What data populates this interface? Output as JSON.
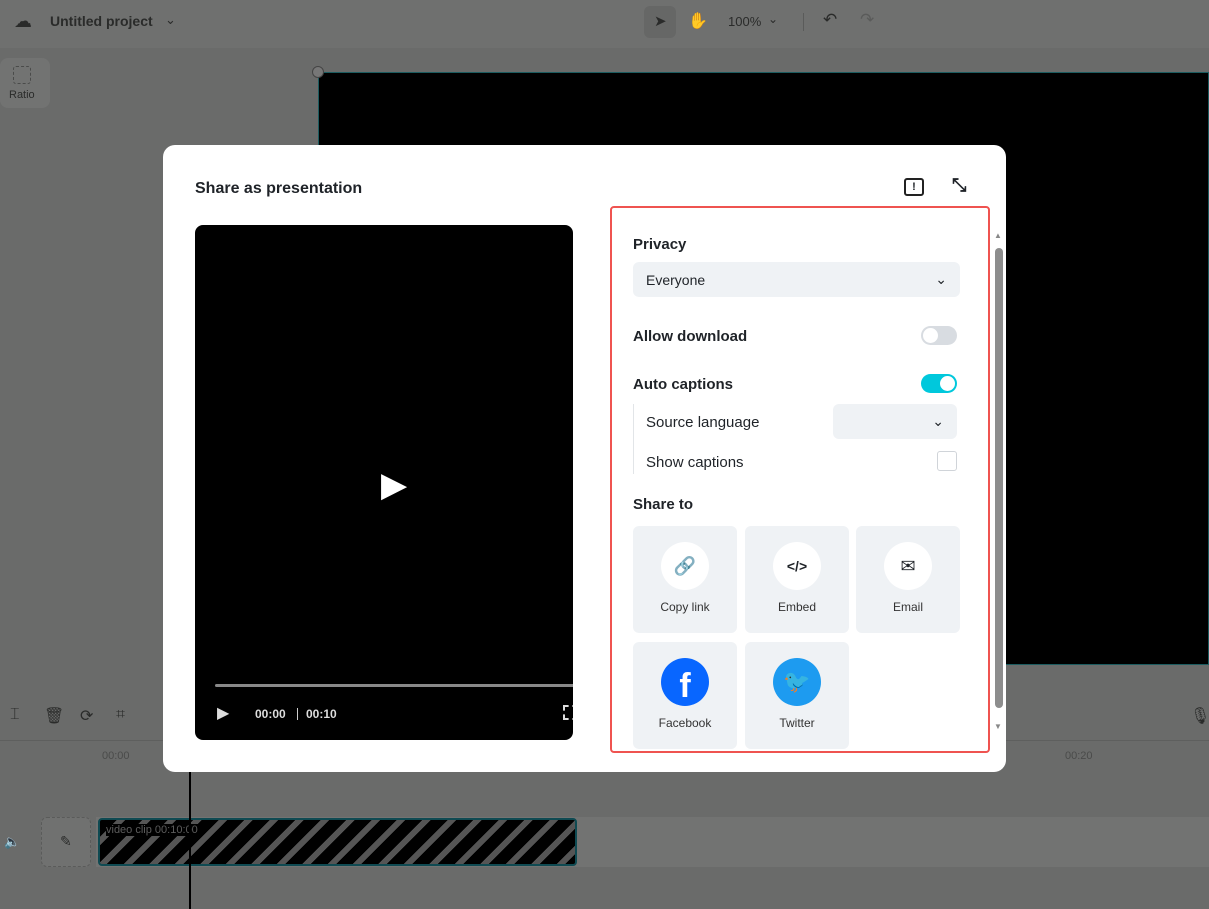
{
  "header": {
    "project_title": "Untitled project",
    "zoom": "100%"
  },
  "sidebar": {
    "ratio_label": "Ratio"
  },
  "timeline": {
    "ruler_start": "00:00",
    "ruler_end": "00:20",
    "clip_label": "video clip",
    "clip_time": "00:10:00"
  },
  "modal": {
    "title": "Share as presentation",
    "player": {
      "current_time": "00:00",
      "duration": "00:10",
      "progress": 0
    },
    "privacy": {
      "label": "Privacy",
      "value": "Everyone"
    },
    "allow_download": {
      "label": "Allow download",
      "on": false
    },
    "auto_captions": {
      "label": "Auto captions",
      "on": true
    },
    "source_language": {
      "label": "Source language",
      "value": ""
    },
    "show_captions": {
      "label": "Show captions",
      "checked": false
    },
    "share_to": {
      "label": "Share to",
      "items": [
        {
          "label": "Copy link",
          "icon": "link-icon"
        },
        {
          "label": "Embed",
          "icon": "code-icon"
        },
        {
          "label": "Email",
          "icon": "mail-icon"
        },
        {
          "label": "Facebook",
          "icon": "facebook-icon"
        },
        {
          "label": "Twitter",
          "icon": "twitter-icon"
        }
      ]
    },
    "colors": {
      "accent": "#00c8dc",
      "highlight": "#ef5350",
      "facebook": "#0866ff",
      "twitter": "#1d9bf0"
    }
  }
}
